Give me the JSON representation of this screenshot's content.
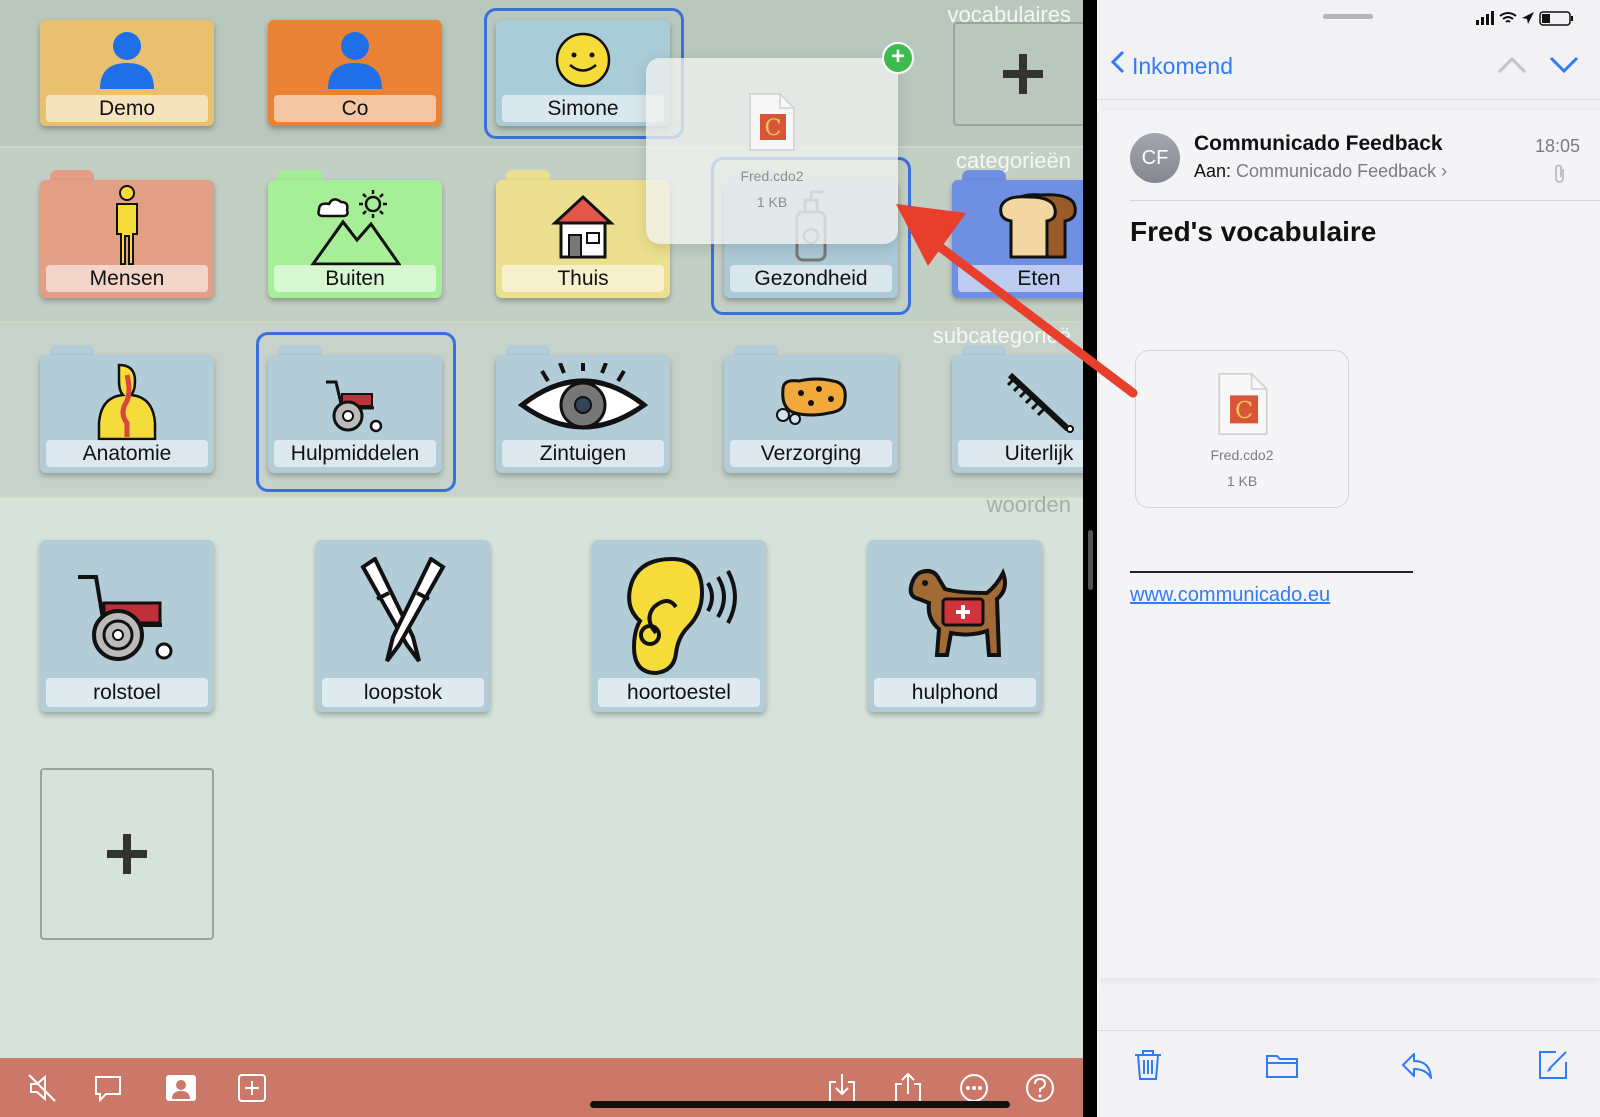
{
  "left_app": {
    "sections": {
      "vocabularies": "vocabulaires",
      "categories": "categorieën",
      "subcategories": "subcategorieë",
      "words": "woorden"
    },
    "vocab_tiles": [
      {
        "label": "Demo",
        "color": "#e8c06f"
      },
      {
        "label": "Co",
        "color": "#e98235"
      },
      {
        "label": "Simone",
        "color": "#a9ccd9"
      }
    ],
    "category_tiles": [
      {
        "label": "Mensen",
        "color": "#e39f86"
      },
      {
        "label": "Buiten",
        "color": "#a7ee98"
      },
      {
        "label": "Thuis",
        "color": "#ecdf8f"
      },
      {
        "label": "Gezondheid",
        "color": "#acc9d6"
      },
      {
        "label": "Eten",
        "color": "#6f8fe3"
      }
    ],
    "subcategory_tiles": [
      {
        "label": "Anatomie"
      },
      {
        "label": "Hulpmiddelen"
      },
      {
        "label": "Zintuigen"
      },
      {
        "label": "Verzorging"
      },
      {
        "label": "Uiterlijk"
      }
    ],
    "word_tiles": [
      {
        "label": "rolstoel",
        "icon": "wheelchair-icon"
      },
      {
        "label": "loopstok",
        "icon": "crutches-icon"
      },
      {
        "label": "hoortoestel",
        "icon": "ear-icon"
      },
      {
        "label": "hulphond",
        "icon": "service-dog-icon"
      }
    ],
    "drag_ghost": {
      "file_name": "Fred.cdo2",
      "file_size": "1 KB"
    },
    "bottom_bar_icons": [
      "mute-icon",
      "speech-bubble-icon",
      "person-icon",
      "add-box-icon",
      "import-icon",
      "share-icon",
      "more-icon",
      "help-icon"
    ],
    "accent": "#3a6fe0",
    "bottom_bar_color": "#cc7868"
  },
  "mail": {
    "back_label": "Inkomend",
    "avatar_initials": "CF",
    "sender": "Communicado Feedback",
    "time": "18:05",
    "to_label": "Aan:",
    "to_name": "Communicado Feedback",
    "subject": "Fred's vocabulaire",
    "attachment": {
      "file_name": "Fred.cdo2",
      "file_size": "1 KB"
    },
    "signature_link": "www.communicado.eu",
    "toolbar_icons": [
      "trash-icon",
      "folder-icon",
      "reply-icon",
      "compose-icon"
    ],
    "link_color": "#2f7cf6"
  }
}
